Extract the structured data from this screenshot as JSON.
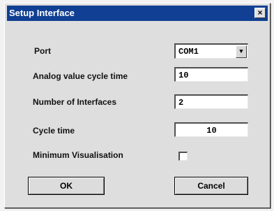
{
  "dialog": {
    "title": "Setup Interface",
    "close_label": "×"
  },
  "form": {
    "port": {
      "label": "Port",
      "value": "COM1"
    },
    "analog_cycle": {
      "label": "Analog value cycle time",
      "value": "10"
    },
    "num_interfaces": {
      "label": "Number of Interfaces",
      "value": "2"
    },
    "cycle_time": {
      "label": "Cycle time",
      "value": "10"
    },
    "min_visualisation": {
      "label": "Minimum Visualisation",
      "checked": false
    }
  },
  "buttons": {
    "ok": "OK",
    "cancel": "Cancel"
  },
  "icons": {
    "dropdown": "chevron-down-icon",
    "close": "close-icon"
  },
  "colors": {
    "titlebar": "#103f93",
    "dialog_bg": "#dedede"
  }
}
